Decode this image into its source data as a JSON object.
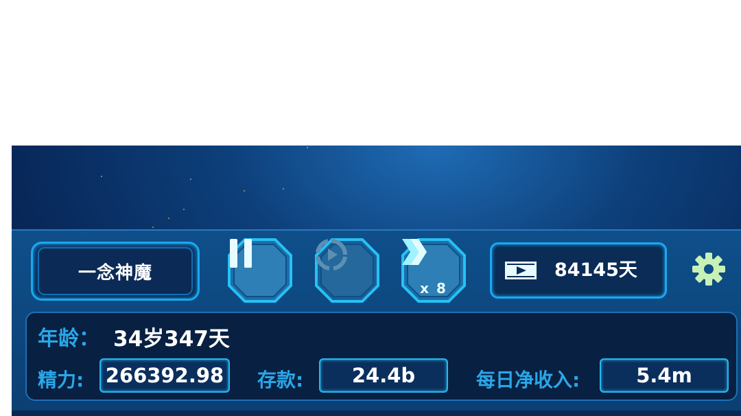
{
  "top_bar": {
    "title": "一念神魔",
    "days_value": "84145天",
    "speed_label": "x 8"
  },
  "icons": {
    "pause": "pause-icon",
    "replay": "replay-icon",
    "fast_forward": "fast-forward-icon",
    "film": "film-play-icon",
    "settings": "gear-icon"
  },
  "stats": {
    "age_label": "年龄：",
    "age_value": "34岁347天",
    "energy_label": "精力:",
    "energy_value": "266392.98",
    "savings_label": "存款:",
    "savings_value": "24.4b",
    "daily_income_label": "每日净收入:",
    "daily_income_value": "5.4m"
  },
  "colors": {
    "accent": "#1aa8f0",
    "label_blue": "#2aa7e8",
    "panel_dark": "#082042"
  }
}
